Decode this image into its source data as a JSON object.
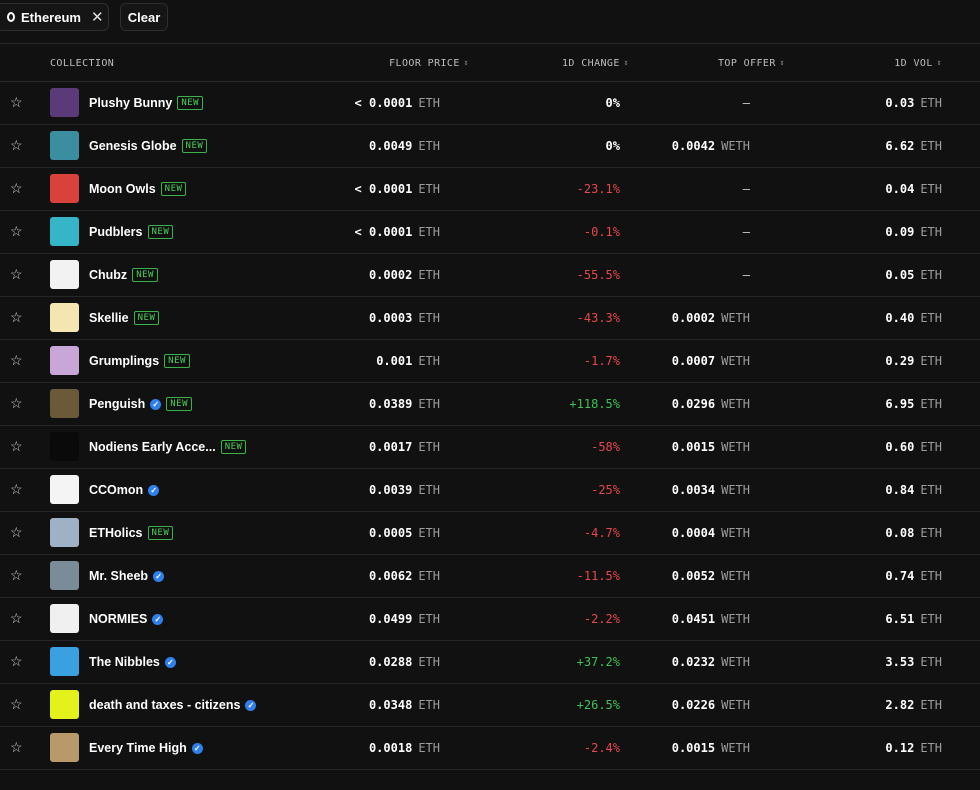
{
  "filters": {
    "chain_chip": "Ethereum",
    "clear_label": "Clear"
  },
  "columns": {
    "collection": "COLLECTION",
    "floor_price": "FLOOR PRICE",
    "change_1d": "1D CHANGE",
    "top_offer": "TOP OFFER",
    "vol_1d": "1D VOL"
  },
  "colors": {
    "positive": "#3fc256",
    "negative": "#e5484d",
    "new_badge": "#4ccc5c",
    "verified": "#2f80ed"
  },
  "rows": [
    {
      "name": "Plushy Bunny",
      "badge": "NEW",
      "verified": false,
      "floor": "< 0.0001",
      "floor_unit": "ETH",
      "change": "0%",
      "change_dir": "flat",
      "offer": "–",
      "offer_unit": "",
      "vol": "0.03",
      "vol_unit": "ETH",
      "thumb": "#5b3a7a"
    },
    {
      "name": "Genesis Globe",
      "badge": "NEW",
      "verified": false,
      "floor": "0.0049",
      "floor_unit": "ETH",
      "change": "0%",
      "change_dir": "flat",
      "offer": "0.0042",
      "offer_unit": "WETH",
      "vol": "6.62",
      "vol_unit": "ETH",
      "thumb": "#3a8ea0"
    },
    {
      "name": "Moon Owls",
      "badge": "NEW",
      "verified": false,
      "floor": "< 0.0001",
      "floor_unit": "ETH",
      "change": "-23.1%",
      "change_dir": "neg",
      "offer": "–",
      "offer_unit": "",
      "vol": "0.04",
      "vol_unit": "ETH",
      "thumb": "#d9423a"
    },
    {
      "name": "Pudblers",
      "badge": "NEW",
      "verified": false,
      "floor": "< 0.0001",
      "floor_unit": "ETH",
      "change": "-0.1%",
      "change_dir": "neg",
      "offer": "–",
      "offer_unit": "",
      "vol": "0.09",
      "vol_unit": "ETH",
      "thumb": "#36b5c8"
    },
    {
      "name": "Chubz",
      "badge": "NEW",
      "verified": false,
      "floor": "0.0002",
      "floor_unit": "ETH",
      "change": "-55.5%",
      "change_dir": "neg",
      "offer": "–",
      "offer_unit": "",
      "vol": "0.05",
      "vol_unit": "ETH",
      "thumb": "#f2f2f2"
    },
    {
      "name": "Skellie",
      "badge": "NEW",
      "verified": false,
      "floor": "0.0003",
      "floor_unit": "ETH",
      "change": "-43.3%",
      "change_dir": "neg",
      "offer": "0.0002",
      "offer_unit": "WETH",
      "vol": "0.40",
      "vol_unit": "ETH",
      "thumb": "#f3e6b0"
    },
    {
      "name": "Grumplings",
      "badge": "NEW",
      "verified": false,
      "floor": "0.001",
      "floor_unit": "ETH",
      "change": "-1.7%",
      "change_dir": "neg",
      "offer": "0.0007",
      "offer_unit": "WETH",
      "vol": "0.29",
      "vol_unit": "ETH",
      "thumb": "#c8a6d8"
    },
    {
      "name": "Penguish",
      "badge": "NEW",
      "verified": true,
      "floor": "0.0389",
      "floor_unit": "ETH",
      "change": "+118.5%",
      "change_dir": "pos",
      "offer": "0.0296",
      "offer_unit": "WETH",
      "vol": "6.95",
      "vol_unit": "ETH",
      "thumb": "#6a5a3a"
    },
    {
      "name": "Nodiens Early Acce...",
      "badge": "NEW",
      "verified": false,
      "floor": "0.0017",
      "floor_unit": "ETH",
      "change": "-58%",
      "change_dir": "neg",
      "offer": "0.0015",
      "offer_unit": "WETH",
      "vol": "0.60",
      "vol_unit": "ETH",
      "thumb": "#0a0a0a"
    },
    {
      "name": "CCOmon",
      "badge": "",
      "verified": true,
      "floor": "0.0039",
      "floor_unit": "ETH",
      "change": "-25%",
      "change_dir": "neg",
      "offer": "0.0034",
      "offer_unit": "WETH",
      "vol": "0.84",
      "vol_unit": "ETH",
      "thumb": "#f4f4f4"
    },
    {
      "name": "ETHolics",
      "badge": "NEW",
      "verified": false,
      "floor": "0.0005",
      "floor_unit": "ETH",
      "change": "-4.7%",
      "change_dir": "neg",
      "offer": "0.0004",
      "offer_unit": "WETH",
      "vol": "0.08",
      "vol_unit": "ETH",
      "thumb": "#9fb1c4"
    },
    {
      "name": "Mr. Sheeb",
      "badge": "",
      "verified": true,
      "floor": "0.0062",
      "floor_unit": "ETH",
      "change": "-11.5%",
      "change_dir": "neg",
      "offer": "0.0052",
      "offer_unit": "WETH",
      "vol": "0.74",
      "vol_unit": "ETH",
      "thumb": "#7a8c98"
    },
    {
      "name": "NORMIES",
      "badge": "",
      "verified": true,
      "floor": "0.0499",
      "floor_unit": "ETH",
      "change": "-2.2%",
      "change_dir": "neg",
      "offer": "0.0451",
      "offer_unit": "WETH",
      "vol": "6.51",
      "vol_unit": "ETH",
      "thumb": "#f0f0f0"
    },
    {
      "name": "The Nibbles",
      "badge": "",
      "verified": true,
      "floor": "0.0288",
      "floor_unit": "ETH",
      "change": "+37.2%",
      "change_dir": "pos",
      "offer": "0.0232",
      "offer_unit": "WETH",
      "vol": "3.53",
      "vol_unit": "ETH",
      "thumb": "#3aa0e0"
    },
    {
      "name": "death and taxes - citizens",
      "badge": "",
      "verified": true,
      "floor": "0.0348",
      "floor_unit": "ETH",
      "change": "+26.5%",
      "change_dir": "pos",
      "offer": "0.0226",
      "offer_unit": "WETH",
      "vol": "2.82",
      "vol_unit": "ETH",
      "thumb": "#e4f21c"
    },
    {
      "name": "Every Time High",
      "badge": "",
      "verified": true,
      "floor": "0.0018",
      "floor_unit": "ETH",
      "change": "-2.4%",
      "change_dir": "neg",
      "offer": "0.0015",
      "offer_unit": "WETH",
      "vol": "0.12",
      "vol_unit": "ETH",
      "thumb": "#b89a6a"
    }
  ]
}
